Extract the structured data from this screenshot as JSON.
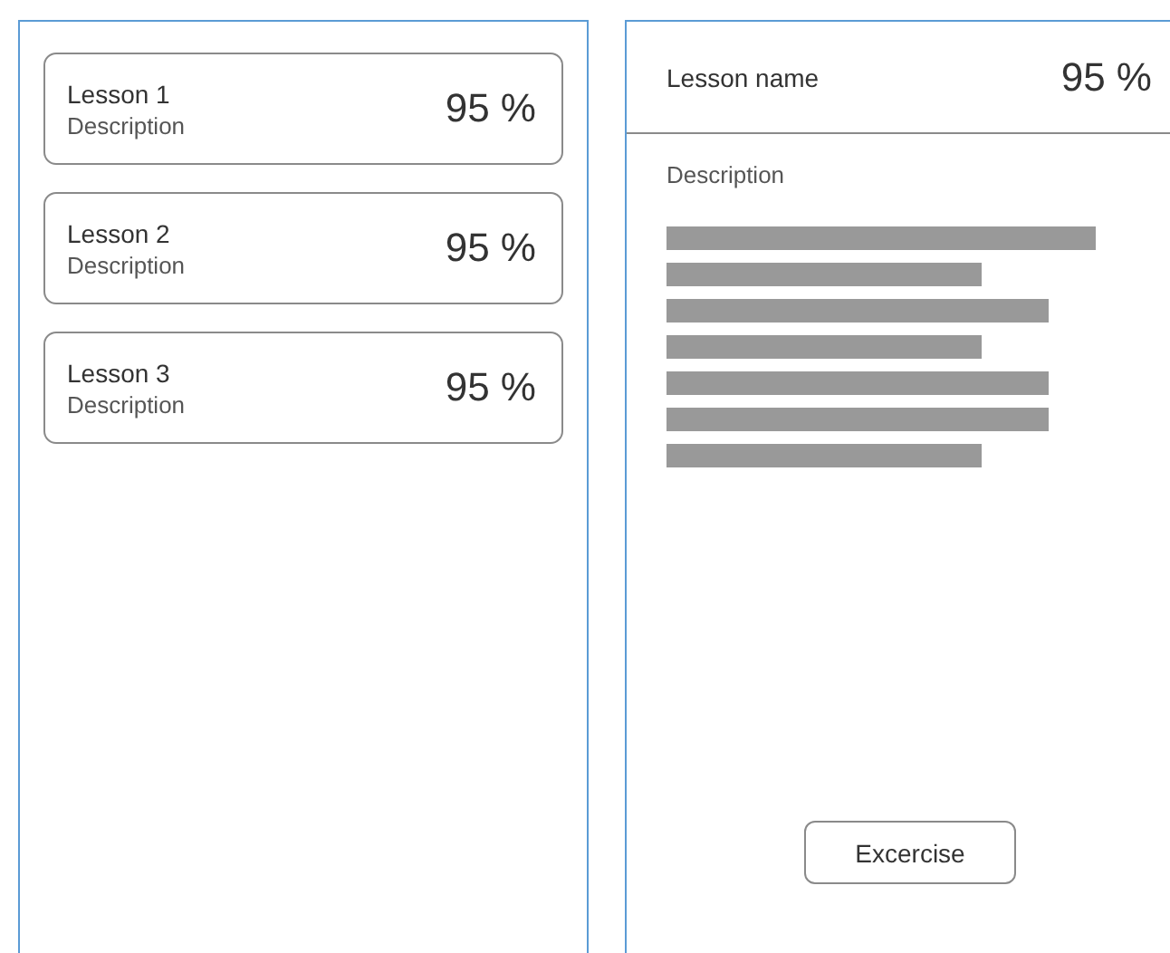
{
  "lessons": [
    {
      "title": "Lesson 1",
      "description": "Description",
      "score": "95 %"
    },
    {
      "title": "Lesson 2",
      "description": "Description",
      "score": "95 %"
    },
    {
      "title": "Lesson 3",
      "description": "Description",
      "score": "95 %"
    }
  ],
  "detail": {
    "title": "Lesson name",
    "score": "95 %",
    "description": "Description",
    "button": "Excercise"
  }
}
